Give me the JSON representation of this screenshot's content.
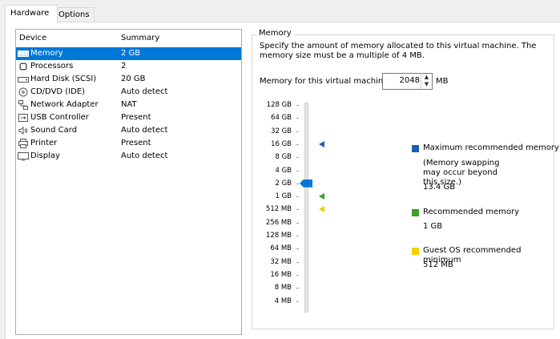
{
  "tabs": [
    {
      "label": "Hardware"
    },
    {
      "label": "Options"
    }
  ],
  "device_list": {
    "columns": {
      "device": "Device",
      "summary": "Summary"
    },
    "rows": [
      {
        "icon": "memory-icon",
        "name": "Memory",
        "summary": "2 GB"
      },
      {
        "icon": "processor-icon",
        "name": "Processors",
        "summary": "2"
      },
      {
        "icon": "hard-disk-icon",
        "name": "Hard Disk (SCSI)",
        "summary": "20 GB"
      },
      {
        "icon": "cd-dvd-icon",
        "name": "CD/DVD (IDE)",
        "summary": "Auto detect"
      },
      {
        "icon": "network-adapter-icon",
        "name": "Network Adapter",
        "summary": "NAT"
      },
      {
        "icon": "usb-controller-icon",
        "name": "USB Controller",
        "summary": "Present"
      },
      {
        "icon": "sound-card-icon",
        "name": "Sound Card",
        "summary": "Auto detect"
      },
      {
        "icon": "printer-icon",
        "name": "Printer",
        "summary": "Present"
      },
      {
        "icon": "display-icon",
        "name": "Display",
        "summary": "Auto detect"
      }
    ],
    "selected_index": 0
  },
  "memory": {
    "group_title": "Memory",
    "description": "Specify the amount of memory allocated to this virtual machine. The memory size must be a multiple of 4 MB.",
    "field_label": "Memory for this virtual machine:",
    "value": "2048",
    "unit": "MB",
    "scale_labels": [
      "128 GB",
      "64 GB",
      "32 GB",
      "16 GB",
      "8 GB",
      "4 GB",
      "2 GB",
      "1 GB",
      "512 MB",
      "256 MB",
      "128 MB",
      "64 MB",
      "32 MB",
      "16 MB",
      "8 MB",
      "4 MB"
    ],
    "current_label": "2 GB",
    "markers": {
      "maximum": "16 GB",
      "recommended": "1 GB",
      "guest_min": "512 MB"
    },
    "legend": {
      "max_title": "Maximum recommended memory",
      "max_note": "(Memory swapping may occur beyond this size.)",
      "max_value": "13.4 GB",
      "rec_title": "Recommended memory",
      "rec_value": "1 GB",
      "min_title": "Guest OS recommended minimum",
      "min_value": "512 MB"
    },
    "colors": {
      "maximum": "#1a5fb4",
      "recommended": "#3f9e26",
      "guest_min": "#f5d000",
      "thumb": "#0078d7"
    }
  }
}
